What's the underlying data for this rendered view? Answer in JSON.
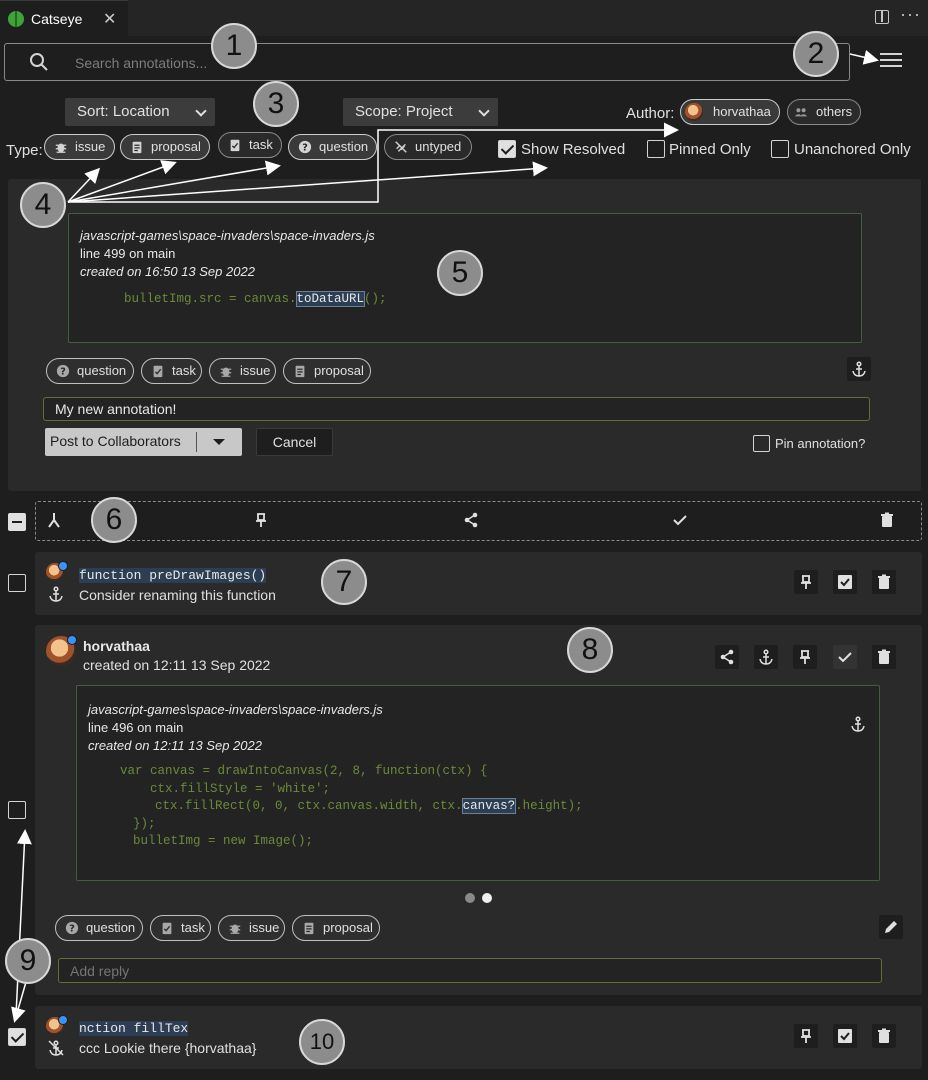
{
  "tab": {
    "title": "Catseye",
    "close": "✕",
    "more": "···"
  },
  "search": {
    "placeholder": "Search annotations..."
  },
  "filters": {
    "sort_label": "Sort: Location",
    "scope_label": "Scope: Project",
    "author_label": "Author:",
    "author_me": "horvathaa",
    "author_others": "others",
    "type_label": "Type:",
    "types": [
      "issue",
      "proposal",
      "task",
      "question",
      "untyped"
    ],
    "show_resolved": "Show Resolved",
    "show_resolved_checked": true,
    "pinned_only": "Pinned Only",
    "pinned_only_checked": false,
    "unanchored_only": "Unanchored Only",
    "unanchored_only_checked": false
  },
  "new_annotation": {
    "file_path": "javascript-games\\space-invaders\\space-invaders.js",
    "line_info": "line 499 on main",
    "created": "created on 16:50 13 Sep 2022",
    "code_before": "bulletImg.src = canvas.",
    "code_highlight": "toDataURL",
    "code_after": "();",
    "types": [
      "question",
      "task",
      "issue",
      "proposal"
    ],
    "input_value": "My new annotation!",
    "post_label": "Post to Collaborators",
    "cancel_label": "Cancel",
    "pin_label": "Pin annotation?"
  },
  "bulk_toolbar": {
    "icons": [
      "merge-icon",
      "pin-icon",
      "share-icon",
      "check-icon",
      "trash-icon"
    ]
  },
  "annotation_collapsed_1": {
    "code": "function preDrawImages()",
    "text": "Consider renaming this function"
  },
  "annotation_expanded": {
    "author": "horvathaa",
    "created": "created on 12:11 13 Sep 2022",
    "file_path": "javascript-games\\space-invaders\\space-invaders.js",
    "line_info": "line 496 on main",
    "snippet_created": "created on 12:11 13 Sep 2022",
    "code_lines": [
      "var canvas = drawIntoCanvas(2, 8, function(ctx) {",
      "    ctx.fillStyle = 'white';",
      "  ctx.fillRect(0, 0, ctx.canvas.width, ctx.",
      "});",
      "bulletImg = new Image();"
    ],
    "code_highlight": "canvas?",
    "code_line3_after": ".height);",
    "types": [
      "question",
      "task",
      "issue",
      "proposal"
    ],
    "reply_placeholder": "Add reply"
  },
  "annotation_collapsed_2": {
    "code": "nction fillTex",
    "text": "ccc Lookie there {horvathaa}"
  },
  "markers": [
    "1",
    "2",
    "3",
    "4",
    "5",
    "6",
    "7",
    "8",
    "9",
    "10"
  ],
  "colors": {
    "background": "#1e1e1e",
    "panel": "#2a2a2a",
    "code_green": "#6a8a3a",
    "highlight": "#2d3e54",
    "accent_blue": "#3794ff"
  }
}
